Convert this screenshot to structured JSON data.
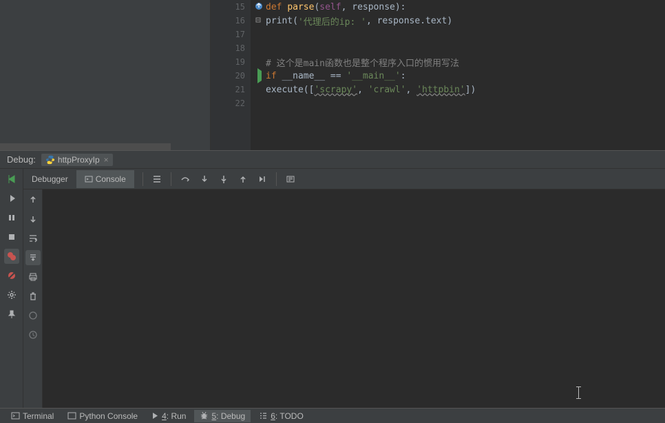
{
  "editor": {
    "lines": [
      {
        "num": "15"
      },
      {
        "num": "16"
      },
      {
        "num": "17"
      },
      {
        "num": "18"
      },
      {
        "num": "19"
      },
      {
        "num": "20"
      },
      {
        "num": "21"
      },
      {
        "num": "22"
      }
    ],
    "code": {
      "l15_def": "def ",
      "l15_fn": "parse",
      "l15_paren": "(",
      "l15_self": "self",
      "l15_rest": ", response):",
      "l16_fn": "print",
      "l16_paren": "(",
      "l16_str": "'代理后的ip: '",
      "l16_rest": ", response.text)",
      "l19_comment": "# 这个是main函数也是整个程序入口的惯用写法",
      "l20_if": "if ",
      "l20_name": "__name__ == ",
      "l20_str": "'__main__'",
      "l20_colon": ":",
      "l21_fn": "execute",
      "l21_open": "([",
      "l21_str1": "'scrapy'",
      "l21_comma1": ", ",
      "l21_str2": "'crawl'",
      "l21_comma2": ", ",
      "l21_str3": "'httpbin'",
      "l21_close": "])"
    }
  },
  "debug": {
    "title": "Debug:",
    "tab_name": "httpProxyIp",
    "tabs": {
      "debugger": "Debugger",
      "console": "Console"
    }
  },
  "bottom": {
    "terminal": "Terminal",
    "python_console": "Python Console",
    "run_num": "4",
    "run": ": Run",
    "debug_num": "5",
    "debug": ": Debug",
    "todo_num": "6",
    "todo": ": TODO"
  },
  "icons": {
    "override": "override-icon",
    "collapse": "collapse-icon",
    "play": "play-icon"
  }
}
